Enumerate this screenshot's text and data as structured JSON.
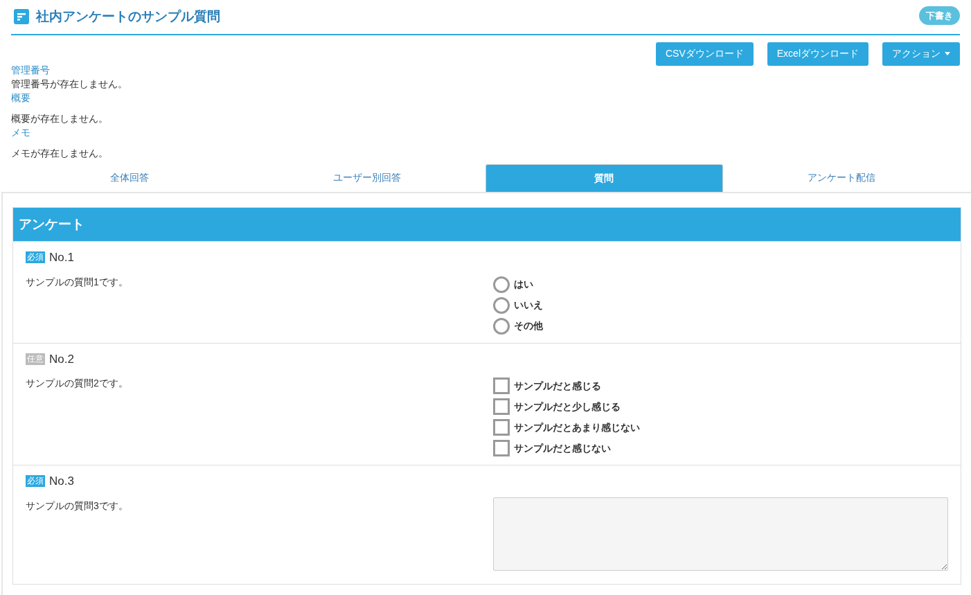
{
  "header": {
    "title": "社内アンケートのサンプル質問",
    "status_badge": "下書き"
  },
  "actions": [
    {
      "label": "CSVダウンロード",
      "kind": "plain"
    },
    {
      "label": "Excelダウンロード",
      "kind": "plain"
    },
    {
      "label": "アクション",
      "kind": "dropdown"
    }
  ],
  "info": [
    {
      "label": "管理番号",
      "value": "管理番号が存在しません。"
    },
    {
      "label": "概要",
      "value": "概要が存在しません。"
    },
    {
      "label": "メモ",
      "value": "メモが存在しません。"
    }
  ],
  "tabs": [
    {
      "label": "全体回答",
      "selected": false
    },
    {
      "label": "ユーザー別回答",
      "selected": false
    },
    {
      "label": "質問",
      "selected": true
    },
    {
      "label": "アンケート配信",
      "selected": false
    }
  ],
  "survey": {
    "title": "アンケート",
    "questions": [
      {
        "badge": "必須",
        "required": true,
        "number": "No.1",
        "text": "サンプルの質問1です。",
        "kind": "radio",
        "options": [
          {
            "label": "はい",
            "selected": false
          },
          {
            "label": "いいえ",
            "selected": false
          },
          {
            "label": "その他",
            "selected": false
          }
        ]
      },
      {
        "badge": "任意",
        "required": false,
        "number": "No.2",
        "text": "サンプルの質問2です。",
        "kind": "checkbox",
        "options": [
          {
            "label": "サンプルだと感じる",
            "checked": false
          },
          {
            "label": "サンプルだと少し感じる",
            "checked": false
          },
          {
            "label": "サンプルだとあまり感じない",
            "checked": false
          },
          {
            "label": "サンプルだと感じない",
            "checked": false
          }
        ]
      },
      {
        "badge": "必須",
        "required": true,
        "number": "No.3",
        "text": "サンプルの質問3です。",
        "kind": "textarea"
      }
    ]
  }
}
